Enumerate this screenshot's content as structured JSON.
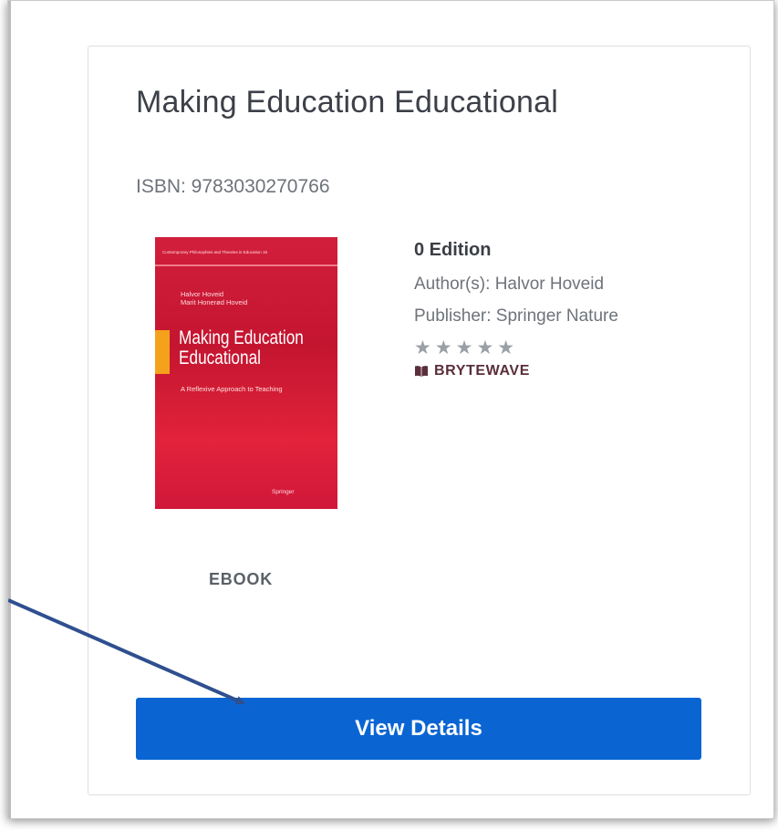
{
  "book": {
    "title": "Making Education Educational",
    "isbn": "ISBN: 9783030270766",
    "edition": "0 Edition",
    "author_label": "Author(s):",
    "author": "Halvor Hoveid",
    "publisher_label": "Publisher:",
    "publisher": "Springer Nature",
    "rating_stars": "★★★★★",
    "seller": "BRYTEWAVE",
    "format": "EBOOK",
    "view_details_label": "View Details"
  },
  "cover": {
    "series": "Contemporary Philosophies and Theories in Education 15",
    "authors_line1": "Halvor Hoveid",
    "authors_line2": "Marit Honerød Hoveid",
    "title_line1": "Making Education",
    "title_line2": "Educational",
    "subtitle": "A Reflexive Approach to Teaching",
    "publisher_logo": "Springer"
  },
  "colors": {
    "button": "#0a65d3",
    "arrow": "#2f4f8f",
    "cover": "#d11f3c",
    "accent": "#f4a21b"
  }
}
